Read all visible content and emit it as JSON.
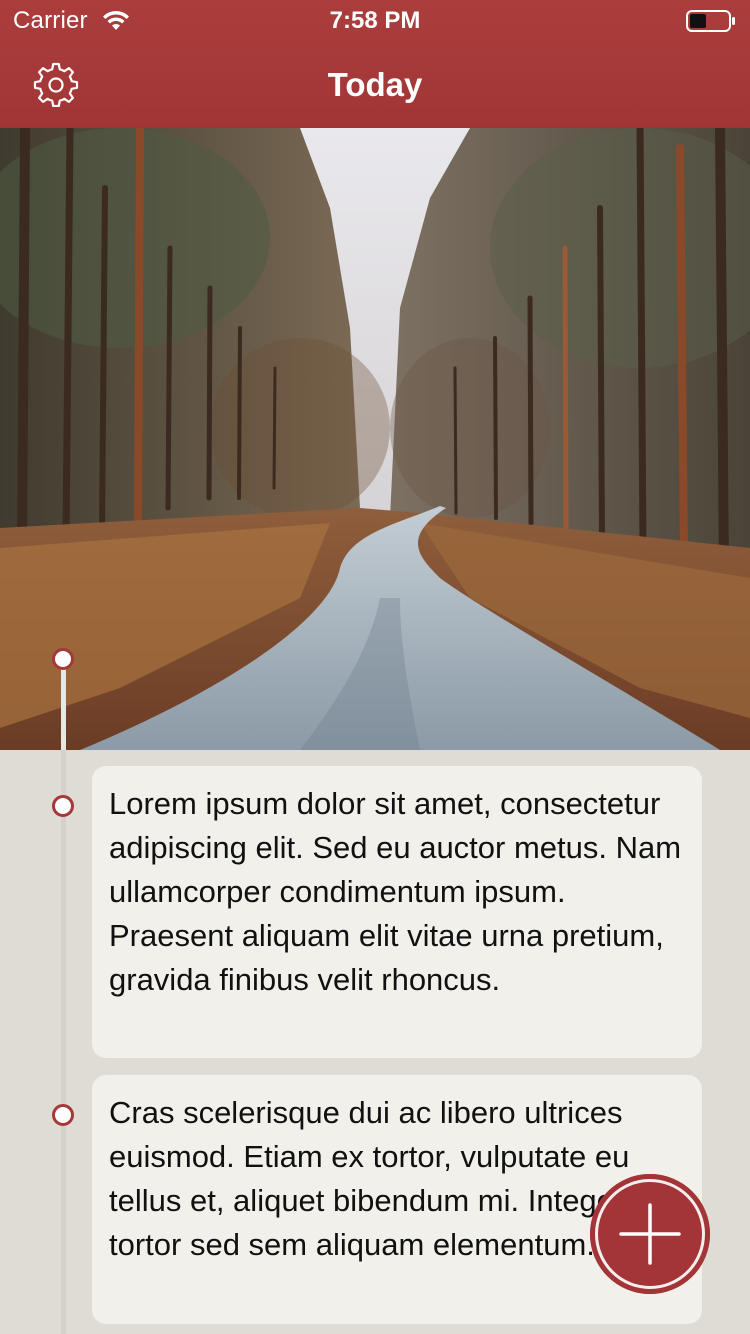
{
  "status_bar": {
    "carrier": "Carrier",
    "time": "7:58 PM",
    "wifi_icon": "wifi-icon",
    "battery_icon": "battery-icon"
  },
  "nav": {
    "title": "Today",
    "settings_icon": "gear-icon"
  },
  "hero": {
    "subject": "forest road photo"
  },
  "entries": [
    {
      "text": "Lorem ipsum dolor sit amet, consectetur adipiscing elit. Sed eu auctor metus. Nam ullamcorper condimentum ipsum. Praesent aliquam elit vitae urna pretium, gravida finibus velit rhoncus."
    },
    {
      "text": "Cras scelerisque dui ac libero ultrices euismod. Etiam ex tortor, vulputate eu tellus et, aliquet bibendum mi. Integer in tortor sed sem aliquam elementum."
    }
  ],
  "fab": {
    "icon": "plus-icon"
  },
  "colors": {
    "accent": "#a6383a",
    "header": "#a13535",
    "background": "#dedcd5",
    "card": "#f1f0ea"
  }
}
